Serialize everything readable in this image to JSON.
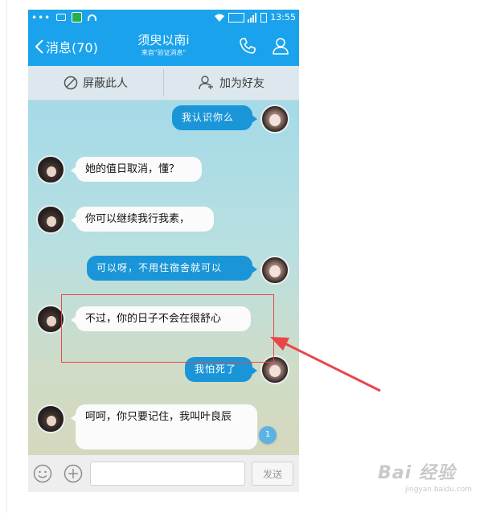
{
  "status_bar": {
    "left_indicator": "•••",
    "signal_label": "",
    "time": "13:55"
  },
  "header": {
    "back_label": "消息(70)",
    "title": "须臾以南i",
    "subtitle": "来自\"验证消息\""
  },
  "actions": {
    "block_label": "屏蔽此人",
    "add_friend_label": "加为好友"
  },
  "messages": [
    {
      "sender": "me",
      "text": "我认识你么"
    },
    {
      "sender": "them",
      "text": "她的值日取消，懂？"
    },
    {
      "sender": "them",
      "text": "你可以继续我行我素，"
    },
    {
      "sender": "me",
      "text": "可以呀，不用住宿舍就可以"
    },
    {
      "sender": "them",
      "text": "不过，你的日子不会在很舒心"
    },
    {
      "sender": "me",
      "text": "我怕死了"
    },
    {
      "sender": "them",
      "text": "呵呵，你只要记住，我叫叶良辰"
    }
  ],
  "unread_badge": "1",
  "input": {
    "value": "",
    "placeholder": "",
    "send_label": "发送"
  },
  "watermark": {
    "logo": "Bai 经验",
    "url": "jingyan.baidu.com"
  },
  "colors": {
    "header_blue": "#1aa3ec",
    "outgoing_bubble": "#1a96d8",
    "incoming_bubble": "#fbfbfb",
    "annotation_red": "#e8464a"
  },
  "icons": [
    "chevron-left-icon",
    "phone-icon",
    "profile-icon",
    "block-icon",
    "add-user-icon",
    "emoji-icon",
    "plus-icon"
  ]
}
